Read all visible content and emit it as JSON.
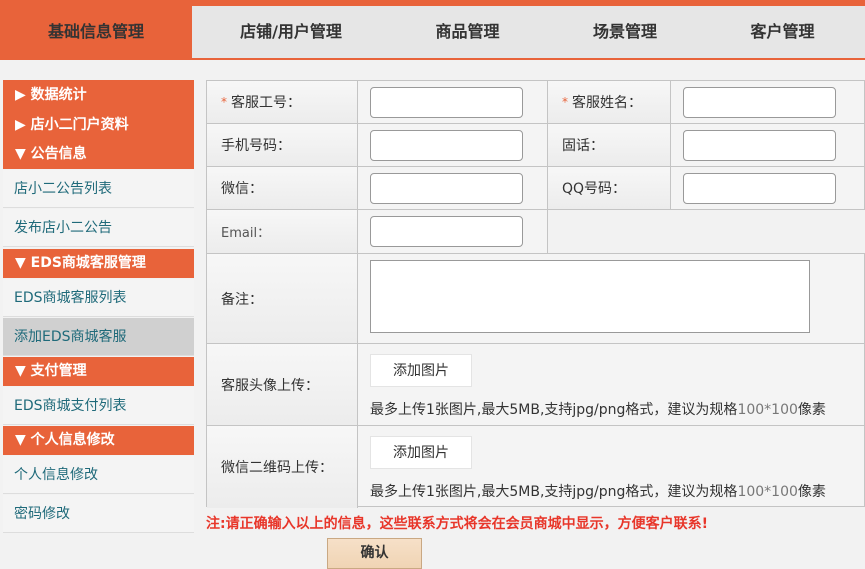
{
  "topnav": {
    "tabs": [
      "基础信息管理",
      "店铺/用户管理",
      "商品管理",
      "场景管理",
      "客户管理"
    ],
    "active_index": 0
  },
  "sidebar": {
    "group1": [
      "▶ 数据统计",
      "▶ 店小二门户资料",
      "▼ 公告信息"
    ],
    "notice_items": [
      "店小二公告列表",
      "发布店小二公告"
    ],
    "group2": "▼ EDS商城客服管理",
    "service_items": [
      "EDS商城客服列表",
      "添加EDS商城客服"
    ],
    "group3": "▼ 支付管理",
    "pay_items": [
      "EDS商城支付列表"
    ],
    "group4": "▼ 个人信息修改",
    "personal_items": [
      "个人信息修改",
      "密码修改"
    ],
    "active_item": "添加EDS商城客服"
  },
  "form": {
    "required_mark": "*",
    "service_id_label": "客服工号：",
    "service_name_label": "客服姓名：",
    "mobile_label": "手机号码：",
    "phone_label": "固话：",
    "wechat_label": "微信：",
    "qq_label": "QQ号码：",
    "email_label": "Email：",
    "remark_label": "备注：",
    "avatar_label": "客服头像上传：",
    "qrcode_label": "微信二维码上传：",
    "add_image_label": "添加图片",
    "upload_hint_a": "最多上传1张图片,最大5MB,支持jpg/png格式，建议为规格",
    "upload_hint_b": "100*100",
    "upload_hint_c": "像素"
  },
  "note": "注:请正确输入以上的信息，这些联系方式将会在会员商城中显示，方便客户联系!",
  "confirm_label": "确认",
  "colors": {
    "accent": "#e8633a",
    "link": "#1f6a7a",
    "warning": "#e8362a"
  }
}
